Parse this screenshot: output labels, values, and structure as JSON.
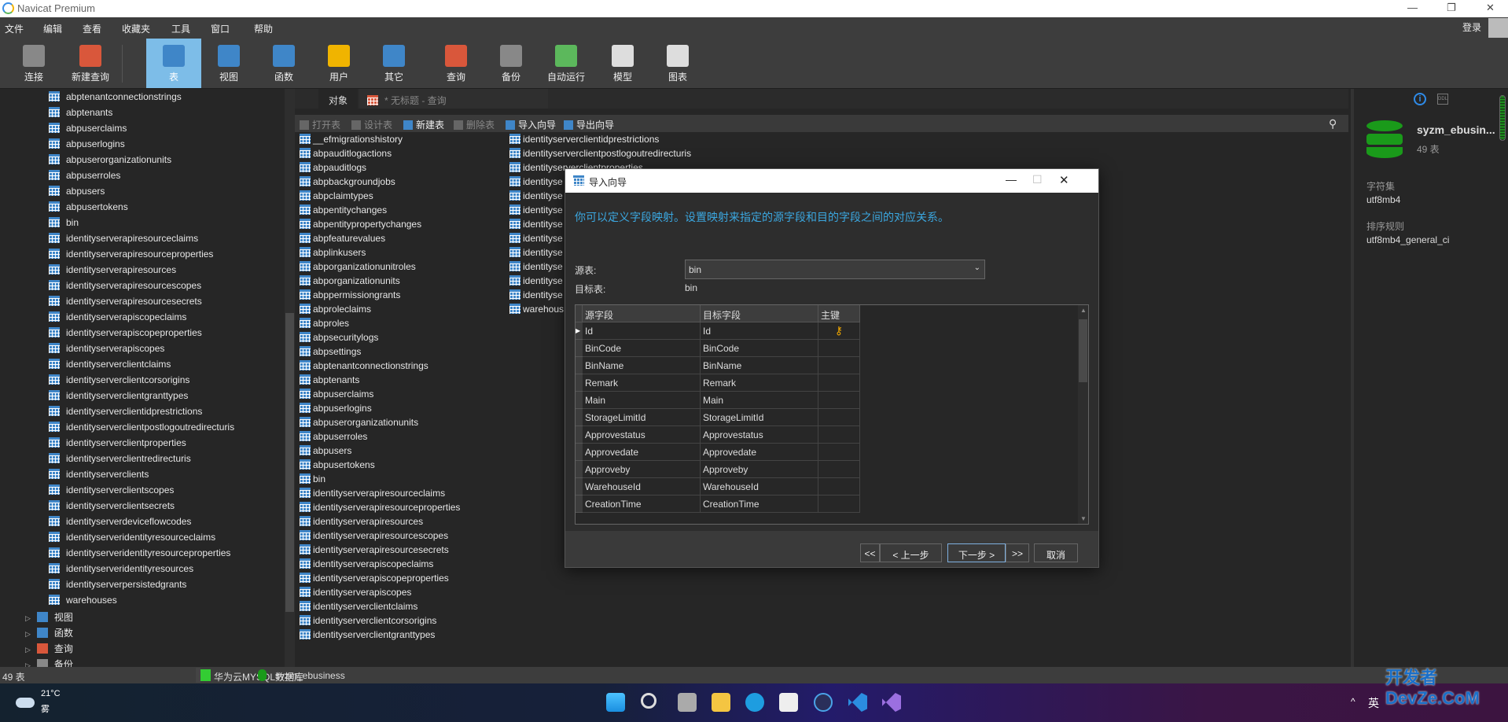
{
  "app": {
    "title": "Navicat Premium"
  },
  "menu": [
    "文件",
    "编辑",
    "查看",
    "收藏夹",
    "工具",
    "窗口",
    "帮助"
  ],
  "login": "登录",
  "toolbar": [
    {
      "label": "连接",
      "icon": "connect-icon",
      "color": "#888"
    },
    {
      "label": "新建查询",
      "icon": "new-query-icon",
      "color": "#d9573b"
    },
    {
      "label": "表",
      "icon": "table-icon",
      "color": "#3f86c8",
      "active": true
    },
    {
      "label": "视图",
      "icon": "view-icon",
      "color": "#3f86c8"
    },
    {
      "label": "函数",
      "icon": "function-icon",
      "color": "#3f86c8"
    },
    {
      "label": "用户",
      "icon": "user-icon",
      "color": "#f0b400"
    },
    {
      "label": "其它",
      "icon": "tools-icon",
      "color": "#3f86c8"
    },
    {
      "label": "查询",
      "icon": "query-icon",
      "color": "#d9573b"
    },
    {
      "label": "备份",
      "icon": "backup-icon",
      "color": "#888"
    },
    {
      "label": "自动运行",
      "icon": "schedule-icon",
      "color": "#5cb85c"
    },
    {
      "label": "模型",
      "icon": "model-icon",
      "color": "#ddd"
    },
    {
      "label": "图表",
      "icon": "chart-icon",
      "color": "#ddd"
    }
  ],
  "tree": {
    "tables": [
      "abptenantconnectionstrings",
      "abptenants",
      "abpuserclaims",
      "abpuserlogins",
      "abpuserorganizationunits",
      "abpuserroles",
      "abpusers",
      "abpusertokens",
      "bin",
      "identityserverapiresourceclaims",
      "identityserverapiresourceproperties",
      "identityserverapiresources",
      "identityserverapiresourcescopes",
      "identityserverapiresourcesecrets",
      "identityserverapiscopeclaims",
      "identityserverapiscopeproperties",
      "identityserverapiscopes",
      "identityserverclientclaims",
      "identityserverclientcorsorigins",
      "identityserverclientgranttypes",
      "identityserverclientidprestrictions",
      "identityserverclientpostlogoutredirecturis",
      "identityserverclientproperties",
      "identityserverclientredirecturis",
      "identityserverclients",
      "identityserverclientscopes",
      "identityserverclientsecrets",
      "identityserverdeviceflowcodes",
      "identityserveridentityresourceclaims",
      "identityserveridentityresourceproperties",
      "identityserveridentityresources",
      "identityserverpersistedgrants",
      "warehouses"
    ],
    "groups": [
      {
        "label": "视图",
        "color": "#3f86c8"
      },
      {
        "label": "函数",
        "color": "#3f86c8"
      },
      {
        "label": "查询",
        "color": "#d9573b"
      },
      {
        "label": "备份",
        "color": "#888"
      }
    ]
  },
  "tabs": {
    "objects": "对象",
    "query": "* 无标题 - 查询"
  },
  "object_toolbar": [
    {
      "label": "打开表",
      "enabled": false
    },
    {
      "label": "设计表",
      "enabled": false
    },
    {
      "label": "新建表",
      "enabled": true
    },
    {
      "label": "删除表",
      "enabled": false
    },
    {
      "label": "导入向导",
      "enabled": true
    },
    {
      "label": "导出向导",
      "enabled": true
    }
  ],
  "object_list": {
    "col1": [
      "__efmigrationshistory",
      "abpauditlogactions",
      "abpauditlogs",
      "abpbackgroundjobs",
      "abpclaimtypes",
      "abpentitychanges",
      "abpentitypropertychanges",
      "abpfeaturevalues",
      "abplinkusers",
      "abporganizationunitroles",
      "abporganizationunits",
      "abppermissiongrants",
      "abproleclaims",
      "abproles",
      "abpsecuritylogs",
      "abpsettings",
      "abptenantconnectionstrings",
      "abptenants",
      "abpuserclaims",
      "abpuserlogins",
      "abpuserorganizationunits",
      "abpuserroles",
      "abpusers",
      "abpusertokens",
      "bin",
      "identityserverapiresourceclaims",
      "identityserverapiresourceproperties",
      "identityserverapiresources",
      "identityserverapiresourcescopes",
      "identityserverapiresourcesecrets",
      "identityserverapiscopeclaims",
      "identityserverapiscopeproperties",
      "identityserverapiscopes",
      "identityserverclientclaims",
      "identityserverclientcorsorigins",
      "identityserverclientgranttypes"
    ],
    "col2": [
      "identityserverclientidprestrictions",
      "identityserverclientpostlogoutredirecturis",
      "identityserverclientproperties",
      "identityse",
      "identityse",
      "identityse",
      "identityse",
      "identityse",
      "identityse",
      "identityse",
      "identityse",
      "identityse",
      "warehous"
    ]
  },
  "info": {
    "db_name": "syzm_ebusin...",
    "table_count": "49 表",
    "charset_label": "字符集",
    "charset": "utf8mb4",
    "collation_label": "排序规则",
    "collation": "utf8mb4_general_ci"
  },
  "status": {
    "count": "49 表",
    "connection": "华为云MYSQL数据库",
    "database": "syzm_ebusiness"
  },
  "taskbar": {
    "temp": "21°C",
    "weather": "雾",
    "ime": "英",
    "watermark": "开发者 DevZe.CoM"
  },
  "dialog": {
    "title": "导入向导",
    "heading": "你可以定义字段映射。设置映射来指定的源字段和目的字段之间的对应关系。",
    "source_label": "源表:",
    "source_value": "bin",
    "target_label": "目标表:",
    "target_value": "bin",
    "columns": [
      "源字段",
      "目标字段",
      "主键"
    ],
    "rows": [
      {
        "source": "Id",
        "target": "Id",
        "pk": true
      },
      {
        "source": "BinCode",
        "target": "BinCode",
        "pk": false
      },
      {
        "source": "BinName",
        "target": "BinName",
        "pk": false
      },
      {
        "source": "Remark",
        "target": "Remark",
        "pk": false
      },
      {
        "source": "Main",
        "target": "Main",
        "pk": false
      },
      {
        "source": "StorageLimitId",
        "target": "StorageLimitId",
        "pk": false
      },
      {
        "source": "Approvestatus",
        "target": "Approvestatus",
        "pk": false
      },
      {
        "source": "Approvedate",
        "target": "Approvedate",
        "pk": false
      },
      {
        "source": "Approveby",
        "target": "Approveby",
        "pk": false
      },
      {
        "source": "WarehouseId",
        "target": "WarehouseId",
        "pk": false
      },
      {
        "source": "CreationTime",
        "target": "CreationTime",
        "pk": false
      }
    ],
    "buttons": {
      "first": "<<",
      "prev": "< 上一步",
      "next": "下一步 >",
      "last": ">>",
      "cancel": "取消"
    }
  }
}
